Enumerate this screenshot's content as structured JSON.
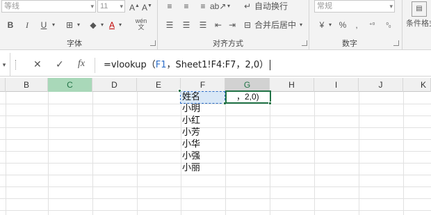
{
  "ribbon": {
    "font_name": "等线",
    "font_size": "11",
    "font_group": "字体",
    "align_group": "对齐方式",
    "number_group": "数字",
    "wrap_text": "自动换行",
    "merge_center": "合并后居中",
    "number_format": "常规",
    "conditional_format": "条件格式",
    "currency_symbol": "¥",
    "percent_symbol": "%",
    "wen_label": "wén",
    "bold": "B",
    "italic": "I",
    "underline": "U",
    "font_color_glyph": "A"
  },
  "formula_bar": {
    "cancel": "✕",
    "enter": "✓",
    "fx": "fx",
    "text_pre": "=vlookup（",
    "ref1": "F1",
    "sep1": "，",
    "ref2": "Sheet1!F4:F7",
    "text_post": "，2,0）"
  },
  "columns": [
    "B",
    "C",
    "D",
    "E",
    "F",
    "G",
    "H",
    "I",
    "J",
    "K"
  ],
  "cells": {
    "F": [
      "姓名",
      "小明",
      "小红",
      "小芳",
      "小华",
      "小强",
      "小丽"
    ],
    "G1": "，2,0)"
  },
  "colors": {
    "accent": "#217346",
    "ref_blue": "#2f6fc8"
  }
}
